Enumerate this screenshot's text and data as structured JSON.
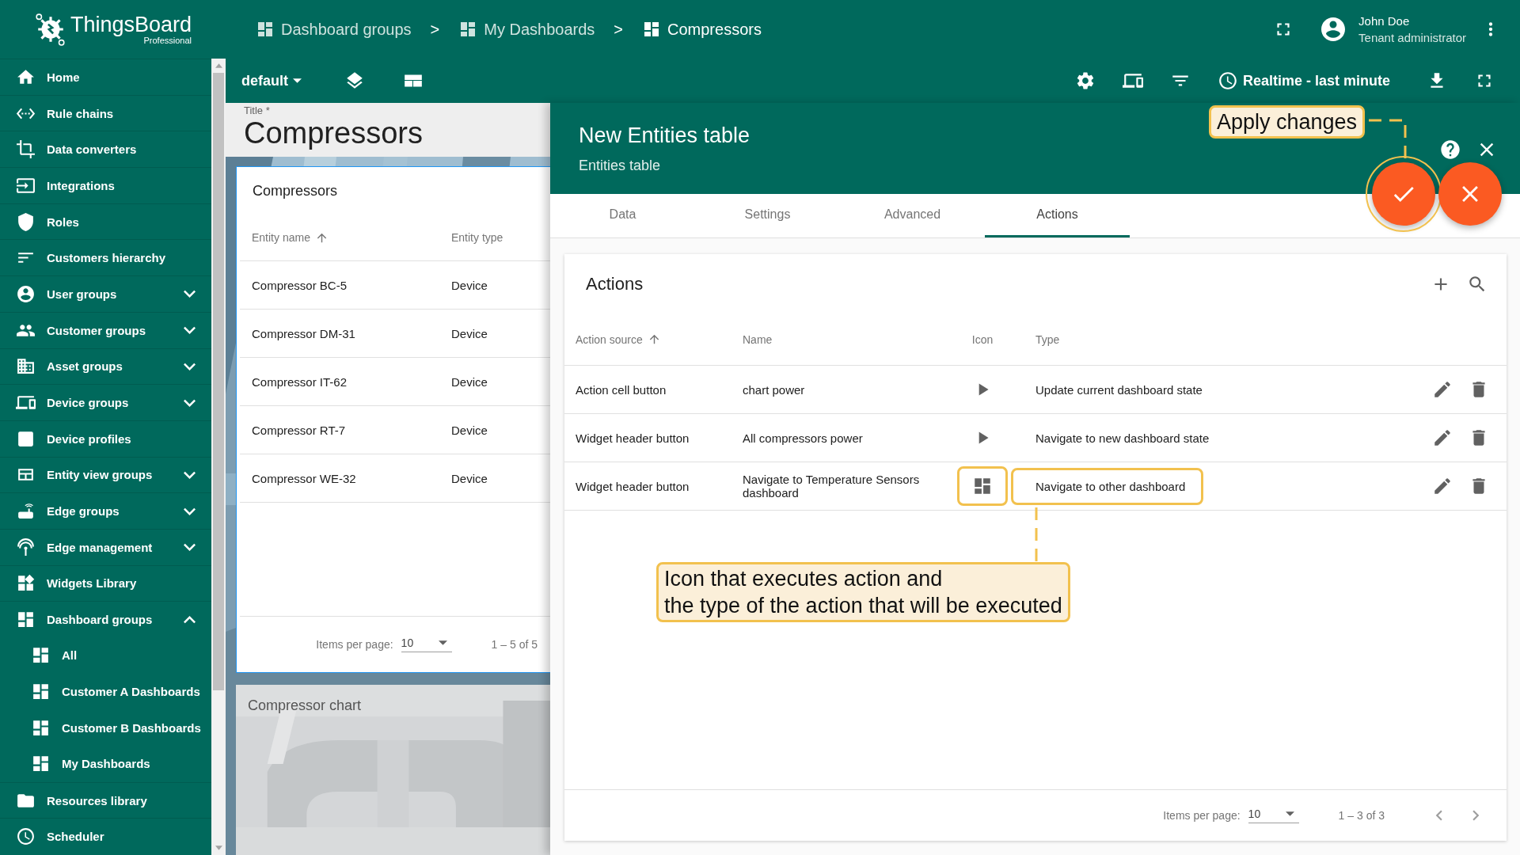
{
  "logo": {
    "name": "ThingsBoard",
    "edition": "Professional"
  },
  "breadcrumbs": {
    "separator": ">",
    "items": [
      "Dashboard groups",
      "My Dashboards",
      "Compressors"
    ]
  },
  "user": {
    "name": "John Doe",
    "role": "Tenant administrator"
  },
  "sidebar": {
    "items": [
      {
        "label": "Home",
        "kind": "link"
      },
      {
        "label": "Rule chains",
        "kind": "link"
      },
      {
        "label": "Data converters",
        "kind": "link"
      },
      {
        "label": "Integrations",
        "kind": "link"
      },
      {
        "label": "Roles",
        "kind": "link"
      },
      {
        "label": "Customers hierarchy",
        "kind": "link"
      },
      {
        "label": "User groups",
        "kind": "group",
        "expanded": false
      },
      {
        "label": "Customer groups",
        "kind": "group",
        "expanded": false
      },
      {
        "label": "Asset groups",
        "kind": "group",
        "expanded": false
      },
      {
        "label": "Device groups",
        "kind": "group",
        "expanded": false
      },
      {
        "label": "Device profiles",
        "kind": "link"
      },
      {
        "label": "Entity view groups",
        "kind": "group",
        "expanded": false
      },
      {
        "label": "Edge groups",
        "kind": "group",
        "expanded": false
      },
      {
        "label": "Edge management",
        "kind": "group",
        "expanded": false
      },
      {
        "label": "Widgets Library",
        "kind": "link"
      },
      {
        "label": "Dashboard groups",
        "kind": "group",
        "expanded": true,
        "children": [
          {
            "label": "All"
          },
          {
            "label": "Customer A Dashboards"
          },
          {
            "label": "Customer B Dashboards"
          },
          {
            "label": "My Dashboards"
          }
        ]
      },
      {
        "label": "Resources library",
        "kind": "link"
      },
      {
        "label": "Scheduler",
        "kind": "link"
      }
    ]
  },
  "toolbar": {
    "state": "default",
    "timewindow": "Realtime - last minute"
  },
  "dashboard": {
    "title_label": "Title *",
    "title": "Compressors",
    "entities_widget": {
      "title": "Compressors",
      "columns": [
        "Entity name",
        "Entity type"
      ],
      "rows": [
        [
          "Compressor BC-5",
          "Device"
        ],
        [
          "Compressor DM-31",
          "Device"
        ],
        [
          "Compressor IT-62",
          "Device"
        ],
        [
          "Compressor RT-7",
          "Device"
        ],
        [
          "Compressor WE-32",
          "Device"
        ]
      ],
      "items_per_page_label": "Items per page:",
      "page_size": "10",
      "range": "1 – 5 of 5"
    },
    "chart_widget": {
      "title": "Compressor chart"
    }
  },
  "panel": {
    "title": "New Entities table",
    "subtitle": "Entities table",
    "tabs": [
      {
        "label": "Data",
        "selected": false
      },
      {
        "label": "Settings",
        "selected": false
      },
      {
        "label": "Advanced",
        "selected": false
      },
      {
        "label": "Actions",
        "selected": true
      }
    ],
    "card": {
      "title": "Actions",
      "columns": [
        "Action source",
        "Name",
        "Icon",
        "Type"
      ],
      "rows": [
        {
          "source": "Action cell button",
          "name": "chart power",
          "kind": "play",
          "type": "Update current dashboard state",
          "highlighted": false
        },
        {
          "source": "Widget header button",
          "name": "All compressors power",
          "kind": "play",
          "type": "Navigate to new dashboard state",
          "highlighted": false
        },
        {
          "source": "Widget header button",
          "name": "Navigate to Temperature Sensors dashboard",
          "kind": "dashboard",
          "type": "Navigate to other dashboard",
          "highlighted": true
        }
      ],
      "items_per_page_label": "Items per page:",
      "page_size": "10",
      "range": "1 – 3 of 3"
    }
  },
  "callouts": [
    {
      "text": "Apply changes"
    },
    {
      "text": "Icon that executes action and\nthe type of the action that will be executed"
    }
  ]
}
